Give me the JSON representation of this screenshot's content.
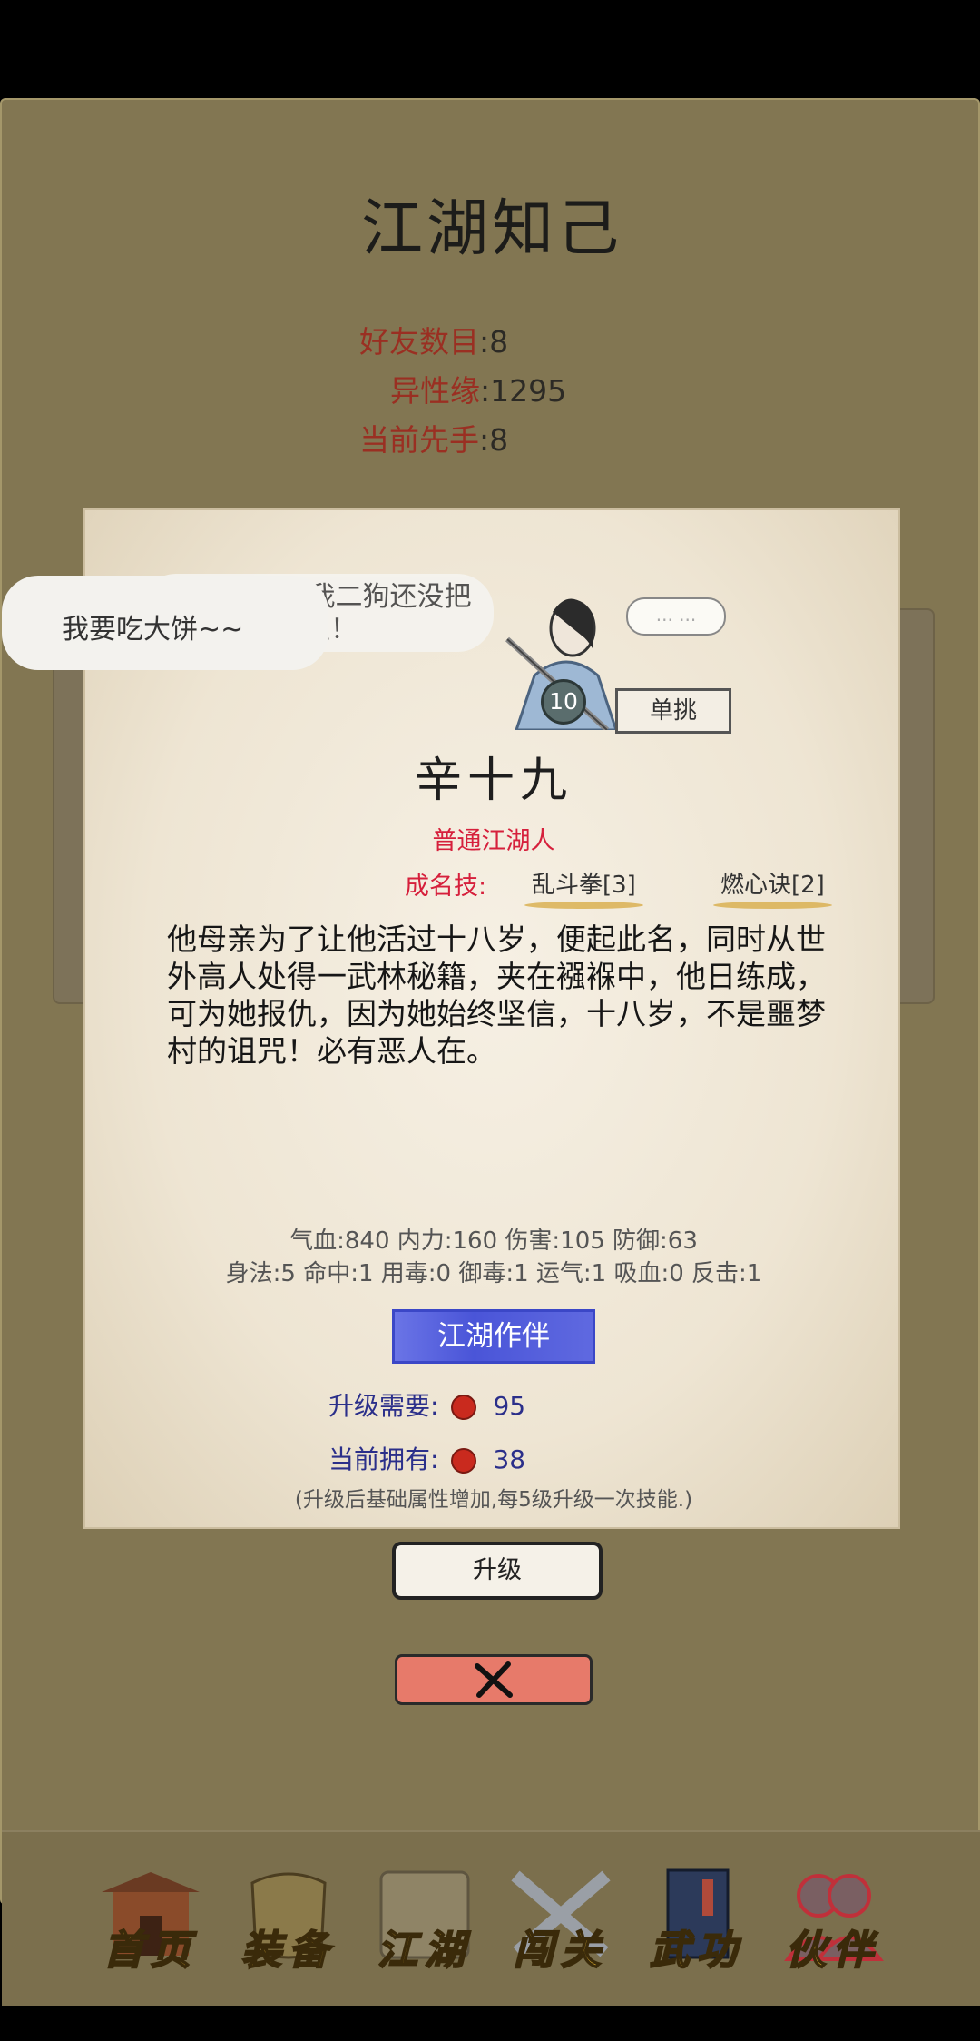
{
  "screen": {
    "title": "江湖知己",
    "stats": [
      {
        "key": "好友数目",
        "value": ":8"
      },
      {
        "key": "异性缘",
        "value": ":1295"
      },
      {
        "key": "当前先手",
        "value": ":8"
      }
    ]
  },
  "card": {
    "speech_main": "我要吃大饼~~",
    "speech_bg_line1": "武林盟主？！ 我二狗还没把",
    "speech_bg_line2": "他放在眼里！",
    "speech_small": "... ...",
    "level": "10",
    "duel_label": "单挑",
    "name": "辛十九",
    "rank": "普通江湖人",
    "skills_label": "成名技:",
    "skills": [
      "乱斗拳[3]",
      "燃心诀[2]"
    ],
    "description": "他母亲为了让他活过十八岁，便起此名，同时从世外高人处得一武林秘籍，夹在襁褓中，他日练成，可为她报仇，因为她始终坚信，十八岁，不是噩梦村的诅咒！必有恶人在。",
    "attrs_line1": "气血:840  内力:160  伤害:105  防御:63",
    "attrs_line2": "身法:5  命中:1  用毒:0  御毒:1  运气:1  吸血:0  反击:1",
    "partner_button": "江湖作伴",
    "upgrade_need_label": "升级需要:",
    "upgrade_need_value": "95",
    "current_have_label": "当前拥有:",
    "current_have_value": "38",
    "note": "(升级后基础属性增加,每5级升级一次技能.)",
    "upgrade_button": "升级"
  },
  "nav": {
    "items": [
      {
        "label": "首页",
        "icon": "building-icon"
      },
      {
        "label": "装备",
        "icon": "armor-icon"
      },
      {
        "label": "江湖",
        "icon": "scroll-icon"
      },
      {
        "label": "闯关",
        "icon": "crossed-swords-icon"
      },
      {
        "label": "武功",
        "icon": "book-icon"
      },
      {
        "label": "伙伴",
        "icon": "partners-icon"
      }
    ]
  },
  "colors": {
    "frame": "#827652",
    "card": "#f4eee2",
    "accent_red": "#d6203c",
    "partner_blue": "#4a55d8",
    "close_salmon": "#e77a6a",
    "nav_gold": "#d6a930"
  }
}
